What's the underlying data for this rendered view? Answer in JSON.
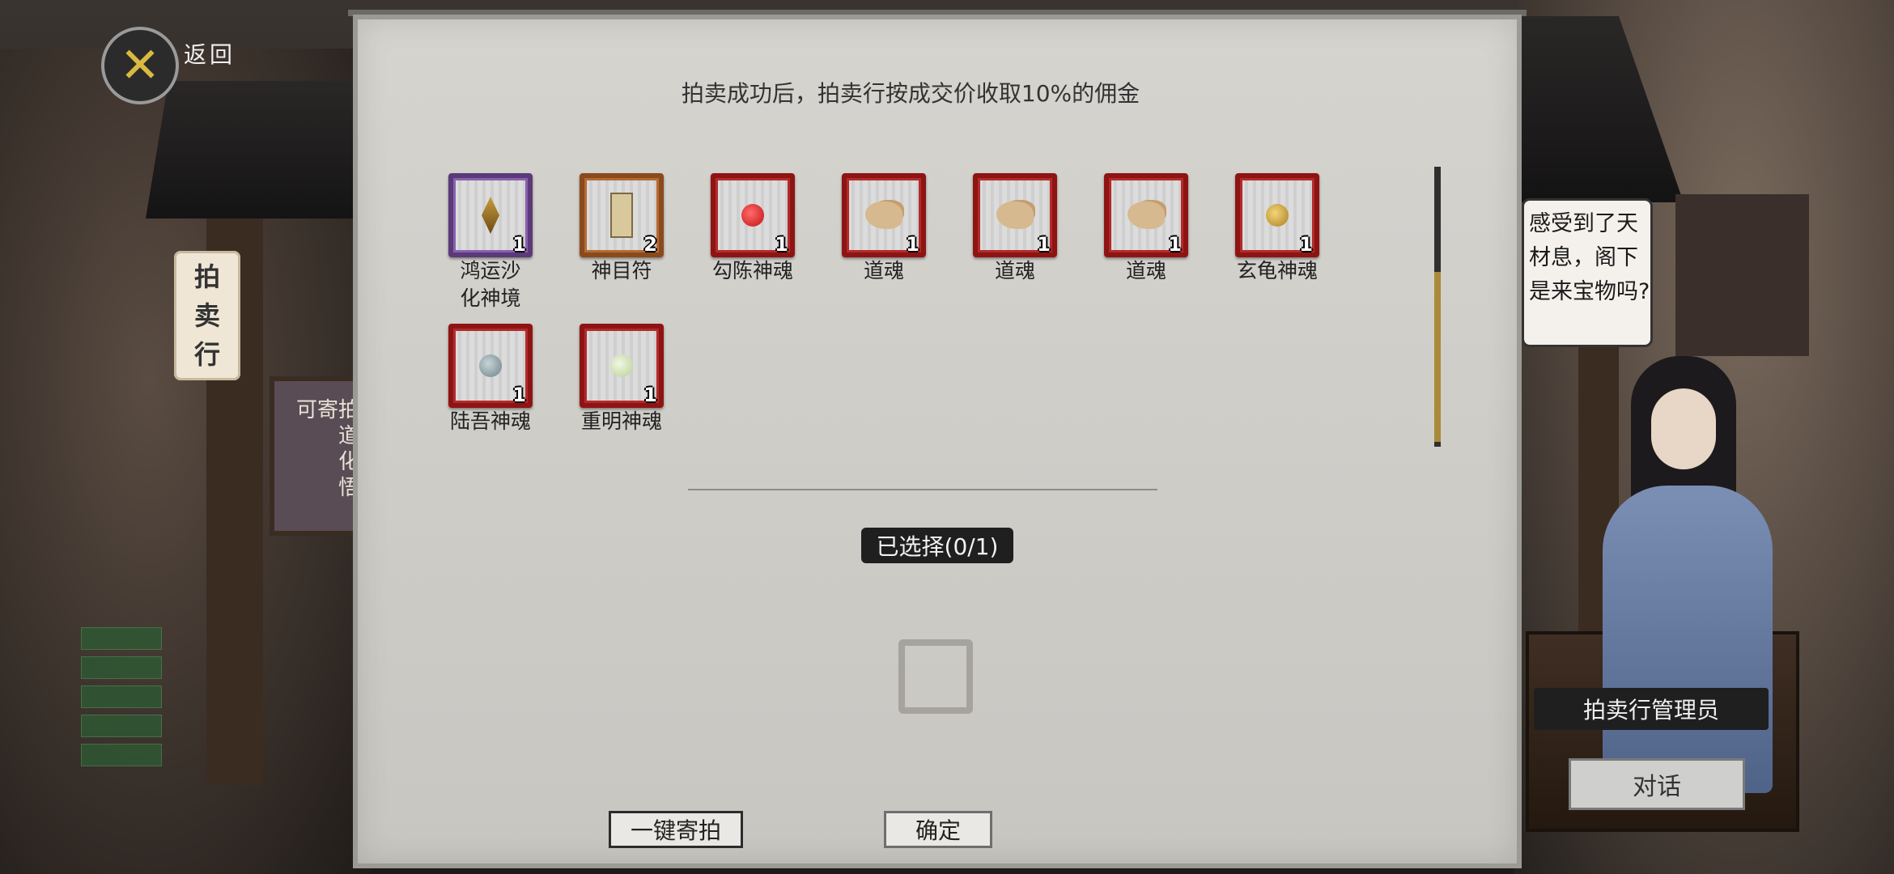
{
  "header": {
    "back_label": "返回"
  },
  "scene": {
    "hanging_sign": [
      "拍",
      "卖",
      "行"
    ],
    "notice": [
      "可寄拍",
      "道",
      "化",
      "悟"
    ],
    "speech": "感受到了天材息，阁下是来宝物吗?",
    "npc_name": "拍卖行管理员",
    "talk_button": "对话"
  },
  "panel": {
    "tip": "拍卖成功后，拍卖行按成交价收取10%的佣金",
    "items": [
      {
        "name": "鸿运沙化神境",
        "name_lines": [
          "鸿运沙",
          "化神境"
        ],
        "count": "1",
        "frame": "purple",
        "icon": "diamond-icon"
      },
      {
        "name": "神目符",
        "count": "2",
        "frame": "orange",
        "icon": "talisman-icon"
      },
      {
        "name": "勾陈神魂",
        "count": "1",
        "frame": "red",
        "icon": "red-orb-icon",
        "color": "#d21f1f"
      },
      {
        "name": "道魂",
        "count": "1",
        "frame": "red",
        "icon": "soul-icon"
      },
      {
        "name": "道魂",
        "count": "1",
        "frame": "red",
        "icon": "soul-icon"
      },
      {
        "name": "道魂",
        "count": "1",
        "frame": "red",
        "icon": "soul-icon"
      },
      {
        "name": "玄龟神魂",
        "count": "1",
        "frame": "red",
        "icon": "gold-orb-icon",
        "color": "#c9a13a"
      },
      {
        "name": "陆吾神魂",
        "count": "1",
        "frame": "red",
        "icon": "blue-orb-icon",
        "color": "#8aa0a6"
      },
      {
        "name": "重明神魂",
        "count": "1",
        "frame": "red",
        "icon": "green-orb-icon",
        "color": "#cfe1b0"
      }
    ],
    "selected_label": "已选择(0/1)",
    "buttons": {
      "auction_all": "一键寄拍",
      "confirm": "确定"
    }
  }
}
